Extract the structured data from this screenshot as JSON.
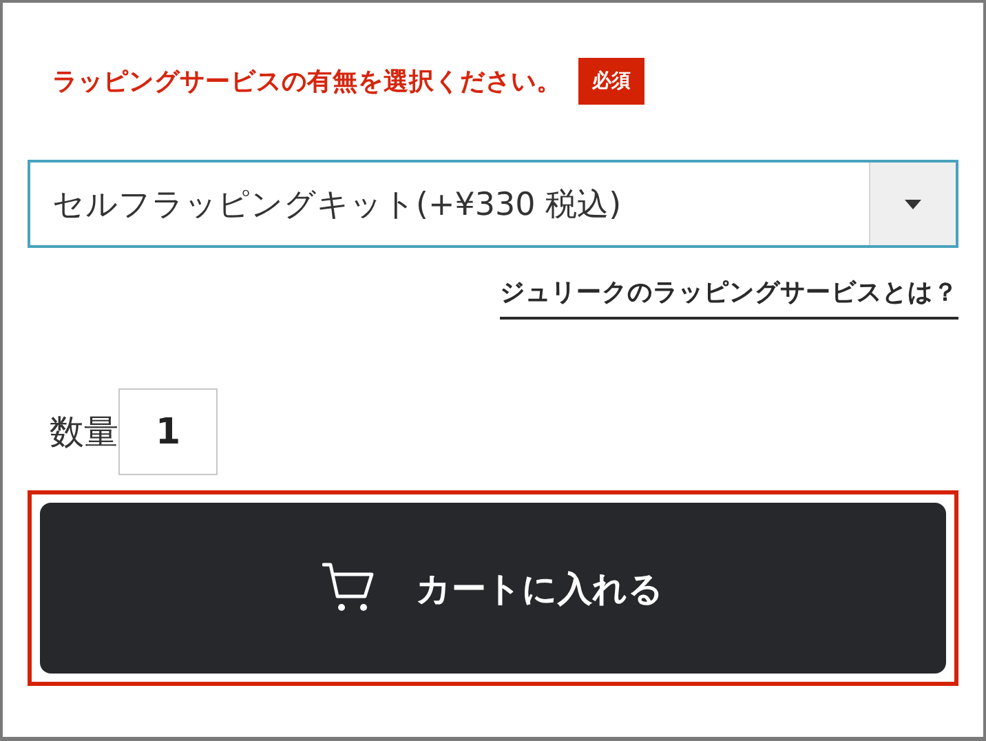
{
  "prompt": {
    "text": "ラッピングサービスの有無を選択ください。",
    "badge": "必須"
  },
  "select": {
    "value": "セルフラッピングキット(+¥330 税込)"
  },
  "link": {
    "text": "ジュリークのラッピングサービスとは？"
  },
  "quantity": {
    "label": "数量",
    "value": "1"
  },
  "cart_button": {
    "label": "カートに入れる",
    "highlighted": true
  }
}
